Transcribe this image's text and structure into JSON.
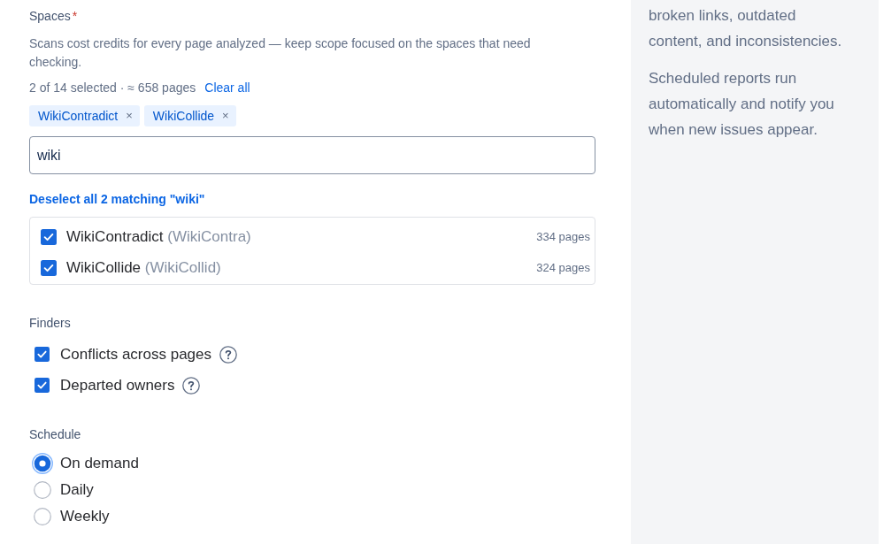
{
  "spaces": {
    "label": "Spaces",
    "required_mark": "*",
    "description": "Scans cost credits for every page analyzed — keep scope focused on the spaces that need checking.",
    "summary": "2 of 14 selected · ≈ 658 pages",
    "clear_all": "Clear all",
    "tags": [
      {
        "label": "WikiContradict",
        "remove": "×"
      },
      {
        "label": "WikiCollide",
        "remove": "×"
      }
    ],
    "search": {
      "value": "wiki"
    },
    "deselect_link": "Deselect all 2 matching \"wiki\"",
    "results": [
      {
        "name": "WikiContradict",
        "key": "(WikiContra)",
        "pages": "334 pages",
        "checked": true
      },
      {
        "name": "WikiCollide",
        "key": "(WikiCollid)",
        "pages": "324 pages",
        "checked": true
      }
    ]
  },
  "finders": {
    "label": "Finders",
    "items": [
      {
        "label": "Conflicts across pages",
        "checked": true,
        "help": true
      },
      {
        "label": "Departed owners",
        "checked": true,
        "help": true
      }
    ]
  },
  "schedule": {
    "label": "Schedule",
    "options": [
      {
        "label": "On demand",
        "selected": true
      },
      {
        "label": "Daily",
        "selected": false
      },
      {
        "label": "Weekly",
        "selected": false
      }
    ]
  },
  "sidebar": {
    "paragraphs": [
      "broken links, outdated content, and inconsistencies.",
      "Scheduled reports run automatically and notify you when new issues appear."
    ]
  }
}
